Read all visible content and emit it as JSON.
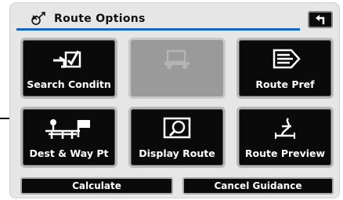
{
  "header": {
    "title": "Route Options",
    "header_icon": "satellite-arrow-icon",
    "back_icon": "return-arrow-icon"
  },
  "tiles": [
    {
      "label": "Search Conditn",
      "icon": "search-conditions-icon",
      "enabled": true
    },
    {
      "label": "",
      "icon": "vehicle-icon",
      "enabled": false
    },
    {
      "label": "Route Pref",
      "icon": "route-preference-icon",
      "enabled": true
    },
    {
      "label": "Dest & Way Pt",
      "icon": "destination-waypoint-icon",
      "enabled": true
    },
    {
      "label": "Display Route",
      "icon": "display-route-icon",
      "enabled": true
    },
    {
      "label": "Route Preview",
      "icon": "route-preview-icon",
      "enabled": true
    }
  ],
  "bottom": {
    "calculate": "Calculate",
    "cancel_guidance": "Cancel Guidance"
  },
  "colors": {
    "accent": "#1565c0",
    "button_bg": "#0a0a0a",
    "panel_bg": "#e6e6e6",
    "disabled": "#9a9a9a"
  }
}
